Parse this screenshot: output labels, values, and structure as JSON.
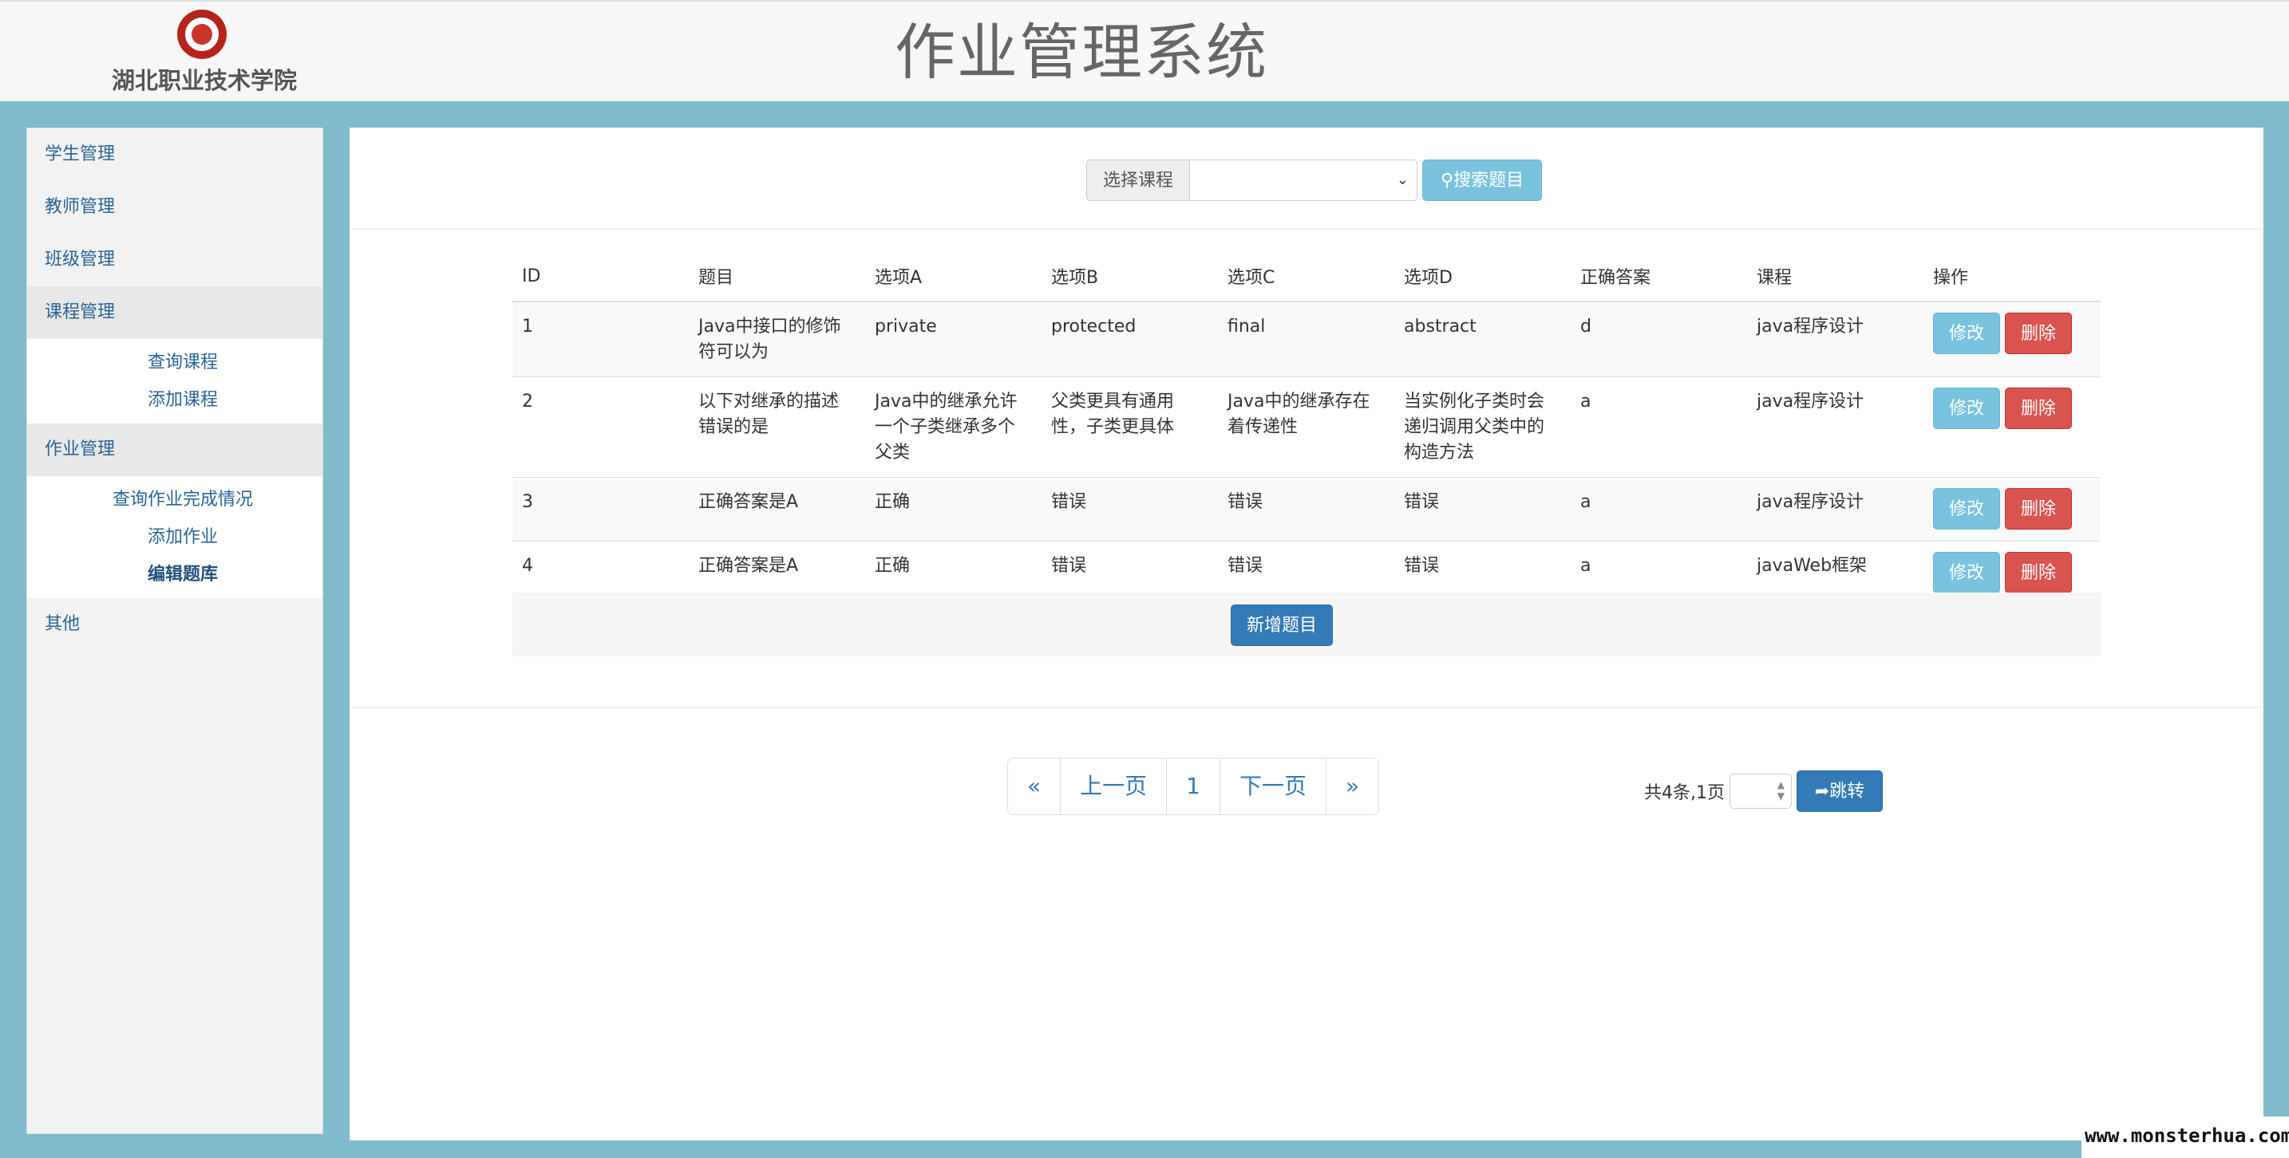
{
  "header": {
    "school_name": "湖北职业技术学院",
    "title": "作业管理系统"
  },
  "sidebar": {
    "items": [
      {
        "label": "学生管理"
      },
      {
        "label": "教师管理"
      },
      {
        "label": "班级管理"
      },
      {
        "label": "课程管理",
        "children": [
          {
            "label": "查询课程"
          },
          {
            "label": "添加课程"
          }
        ]
      },
      {
        "label": "作业管理",
        "children": [
          {
            "label": "查询作业完成情况"
          },
          {
            "label": "添加作业"
          },
          {
            "label": "编辑题库"
          }
        ]
      },
      {
        "label": "其他"
      }
    ]
  },
  "search": {
    "label": "选择课程",
    "selected": "",
    "button": "搜索题目"
  },
  "table": {
    "columns": [
      "ID",
      "题目",
      "选项A",
      "选项B",
      "选项C",
      "选项D",
      "正确答案",
      "课程",
      "操作"
    ],
    "rows": [
      [
        "1",
        "Java中接口的修饰符可以为",
        "private",
        "protected",
        "final",
        "abstract",
        "d",
        "java程序设计"
      ],
      [
        "2",
        "以下对继承的描述错误的是",
        "Java中的继承允许一个子类继承多个父类",
        "父类更具有通用性，子类更具体",
        "Java中的继承存在着传递性",
        "当实例化子类时会递归调用父类中的构造方法",
        "a",
        "java程序设计"
      ],
      [
        "3",
        "正确答案是A",
        "正确",
        "错误",
        "错误",
        "错误",
        "a",
        "java程序设计"
      ],
      [
        "4",
        "正确答案是A",
        "正确",
        "错误",
        "错误",
        "错误",
        "a",
        "javaWeb框架"
      ]
    ],
    "edit_label": "修改",
    "delete_label": "删除",
    "add_label": "新增题目"
  },
  "pagination": {
    "first": "«",
    "prev": "上一页",
    "current": "1",
    "next": "下一页",
    "last": "»",
    "total": "共4条,1页",
    "jump_label": "跳转"
  },
  "watermark": "www.monsterhua.com",
  "colors": {
    "page_bg": "#7fbbcc",
    "info_button": "#7ac3df",
    "danger_button": "#d9534f",
    "primary_button": "#337ab7",
    "link": "#2a6496"
  }
}
